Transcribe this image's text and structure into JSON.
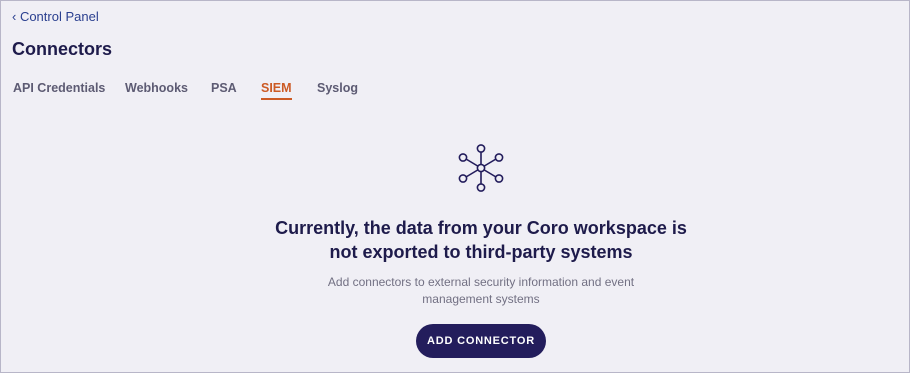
{
  "breadcrumb": {
    "back_label": "‹ Control Panel"
  },
  "page": {
    "title": "Connectors"
  },
  "tabs": [
    {
      "label": "API Credentials",
      "active": false
    },
    {
      "label": "Webhooks",
      "active": false
    },
    {
      "label": "PSA",
      "active": false
    },
    {
      "label": "SIEM",
      "active": true
    },
    {
      "label": "Syslog",
      "active": false
    }
  ],
  "empty_state": {
    "icon": "network-hub-icon",
    "title_line1": "Currently, the data from your Coro workspace is",
    "title_line2": "not exported to third-party systems",
    "desc_line1": "Add connectors to external security information and event",
    "desc_line2": "management systems",
    "button_label": "ADD CONNECTOR"
  },
  "colors": {
    "accent": "#cc5a24",
    "primary": "#231d5c",
    "heading": "#1e1b4b",
    "background": "#f0eff5"
  }
}
